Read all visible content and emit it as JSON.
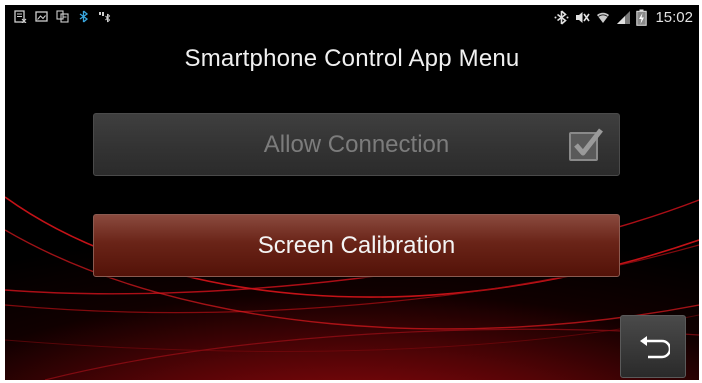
{
  "status_bar": {
    "left_icons": [
      "notification-list-icon",
      "image-icon",
      "sim-icon",
      "bluetooth-icon",
      "signal-bt-icon"
    ],
    "right_icons": [
      "bluetooth-icon",
      "mute-icon",
      "wifi-icon",
      "cell-signal-icon",
      "battery-charging-icon"
    ],
    "time": "15:02"
  },
  "screen": {
    "title": "Smartphone Control App Menu"
  },
  "menu": {
    "allow_connection_label": "Allow Connection",
    "allow_connection_checked": true,
    "allow_connection_enabled": false,
    "screen_calibration_label": "Screen Calibration"
  },
  "nav": {
    "back_icon": "back-arrow-icon"
  },
  "colors": {
    "background": "#000000",
    "accent_red": "#b00a0f",
    "calibration_button": "#6a2418",
    "disabled_button": "#363636"
  }
}
